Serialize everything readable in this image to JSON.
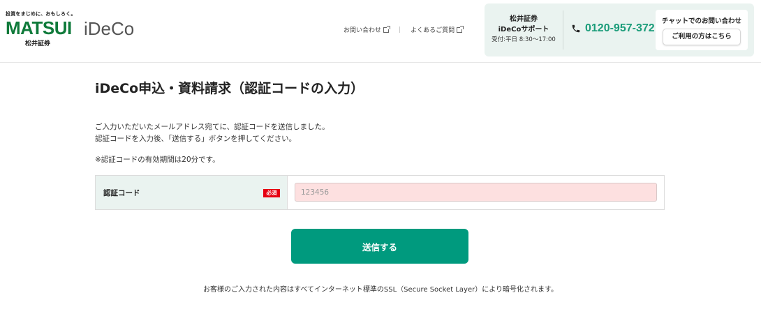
{
  "header": {
    "logo": {
      "tagline": "投資をまじめに、おもしろく。",
      "brand": "MATSUI",
      "brand_sub": "松井証券",
      "product": "iDeCo"
    },
    "links": [
      {
        "label": "お問い合わせ"
      },
      {
        "label": "よくあるご質問"
      }
    ],
    "link_separator": "|",
    "support": {
      "name_line1": "松井証券",
      "name_line2": "iDeCoサポート",
      "hours": "受付:平日 8:30～17:00",
      "phone": "0120-957-372",
      "chat_title": "チャットでのお問い合わせ",
      "chat_button": "ご利用の方はこちら"
    }
  },
  "main": {
    "title": "iDeCo申込・資料請求（認証コードの入力）",
    "description_line1": "ご入力いただいたメールアドレス宛てに、認証コードを送信しました。",
    "description_line2": "認証コードを入力後、「送信する」ボタンを押してください。",
    "note": "※認証コードの有効期間は20分です。",
    "form": {
      "label": "認証コード",
      "required_badge": "必須",
      "input_value": "",
      "input_placeholder": "123456"
    },
    "submit_label": "送信する",
    "ssl_note": "お客様のご入力された内容はすべてインターネット標準のSSL（Secure Socket Layer）により暗号化されます。"
  },
  "icons": {
    "external": "external-link-icon",
    "phone": "phone-icon"
  },
  "colors": {
    "brand_green": "#0f7a3a",
    "accent_teal": "#009a7e",
    "phone_text": "#1a9c79",
    "label_bg": "#eaf3f0",
    "input_bg": "#fde0e0",
    "required_red": "#e60012"
  }
}
